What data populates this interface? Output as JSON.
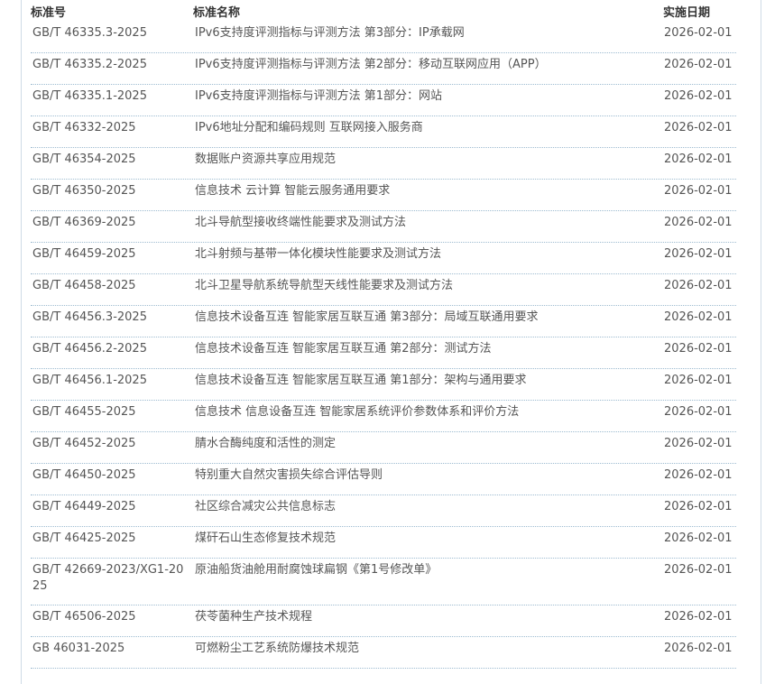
{
  "header": {
    "code": "标准号",
    "name": "标准名称",
    "date": "实施日期"
  },
  "rows": [
    {
      "code": "GB/T 46335.3-2025",
      "name": "IPv6支持度评测指标与评测方法 第3部分：IP承载网",
      "date": "2026-02-01"
    },
    {
      "code": "GB/T 46335.2-2025",
      "name": "IPv6支持度评测指标与评测方法 第2部分：移动互联网应用（APP）",
      "date": "2026-02-01"
    },
    {
      "code": "GB/T 46335.1-2025",
      "name": "IPv6支持度评测指标与评测方法 第1部分：网站",
      "date": "2026-02-01"
    },
    {
      "code": "GB/T 46332-2025",
      "name": "IPv6地址分配和编码规则 互联网接入服务商",
      "date": "2026-02-01"
    },
    {
      "code": "GB/T 46354-2025",
      "name": "数据账户资源共享应用规范",
      "date": "2026-02-01"
    },
    {
      "code": "GB/T 46350-2025",
      "name": "信息技术 云计算 智能云服务通用要求",
      "date": "2026-02-01"
    },
    {
      "code": "GB/T 46369-2025",
      "name": "北斗导航型接收终端性能要求及测试方法",
      "date": "2026-02-01"
    },
    {
      "code": "GB/T 46459-2025",
      "name": "北斗射频与基带一体化模块性能要求及测试方法",
      "date": "2026-02-01"
    },
    {
      "code": "GB/T 46458-2025",
      "name": "北斗卫星导航系统导航型天线性能要求及测试方法",
      "date": "2026-02-01"
    },
    {
      "code": "GB/T 46456.3-2025",
      "name": "信息技术设备互连 智能家居互联互通 第3部分：局域互联通用要求",
      "date": "2026-02-01"
    },
    {
      "code": "GB/T 46456.2-2025",
      "name": "信息技术设备互连 智能家居互联互通 第2部分：测试方法",
      "date": "2026-02-01"
    },
    {
      "code": "GB/T 46456.1-2025",
      "name": "信息技术设备互连 智能家居互联互通 第1部分：架构与通用要求",
      "date": "2026-02-01"
    },
    {
      "code": "GB/T 46455-2025",
      "name": "信息技术 信息设备互连 智能家居系统评价参数体系和评价方法",
      "date": "2026-02-01"
    },
    {
      "code": "GB/T 46452-2025",
      "name": "腈水合酶纯度和活性的测定",
      "date": "2026-02-01"
    },
    {
      "code": "GB/T 46450-2025",
      "name": "特别重大自然灾害损失综合评估导则",
      "date": "2026-02-01"
    },
    {
      "code": "GB/T 46449-2025",
      "name": "社区综合减灾公共信息标志",
      "date": "2026-02-01"
    },
    {
      "code": "GB/T 46425-2025",
      "name": "煤矸石山生态修复技术规范",
      "date": "2026-02-01"
    },
    {
      "code": "GB/T 42669-2023/XG1-2025",
      "name": "原油船货油舱用耐腐蚀球扁钢《第1号修改单》",
      "date": "2026-02-01"
    },
    {
      "code": "GB/T 46506-2025",
      "name": "茯苓菌种生产技术规程",
      "date": "2026-02-01"
    },
    {
      "code": "GB 46031-2025",
      "name": "可燃粉尘工艺系统防爆技术规范",
      "date": "2026-02-01"
    }
  ]
}
